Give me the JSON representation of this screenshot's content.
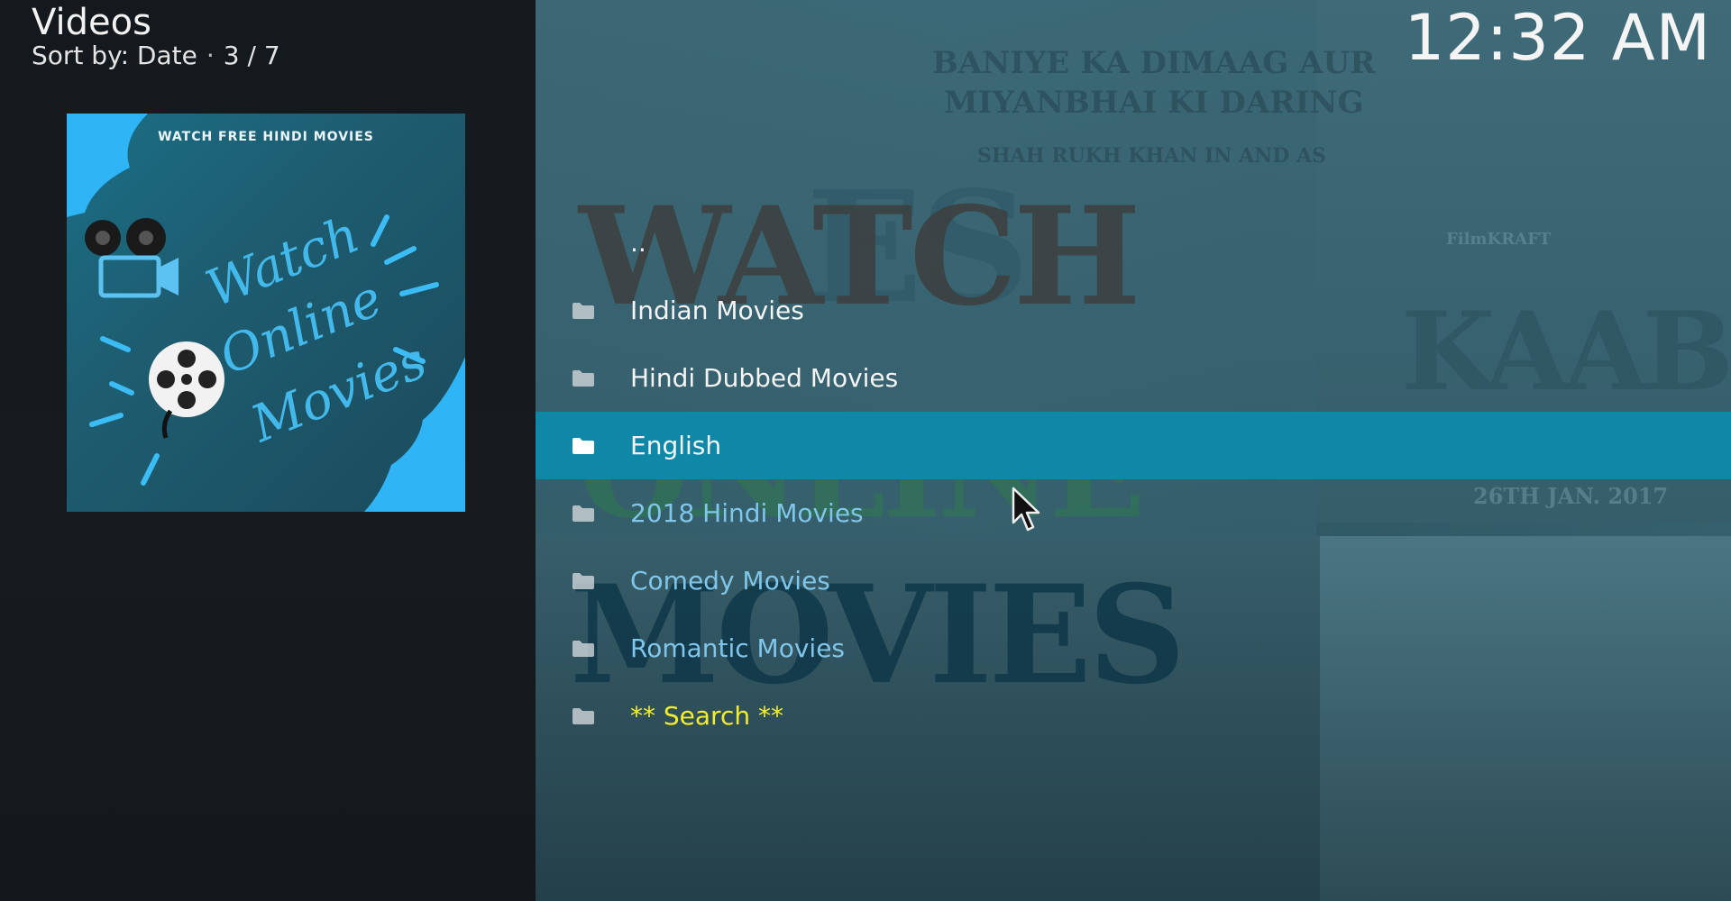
{
  "header": {
    "title": "Videos",
    "sort_label": "Sort by: Date",
    "separator": "·",
    "position": "3 / 7"
  },
  "clock": {
    "time": "12:32 AM"
  },
  "thumbnail": {
    "caption": "WATCH FREE HINDI MOVIES",
    "script_text": "Watch Online Movies"
  },
  "background": {
    "words": [
      "WATCH",
      "ONLINE",
      "MOVIES"
    ],
    "poster_line_1": "BANIYE KA DIMAAG AUR",
    "poster_line_2": "MIYANBHAI KI DARING",
    "poster_line_3": "SHAH RUKH KHAN IN AND AS",
    "poster_studio": "FilmKRAFT",
    "poster_title": "KAABIL",
    "poster_date": "26TH JAN. 2017"
  },
  "list": {
    "items": [
      {
        "label": "..",
        "icon": "none",
        "color": "white",
        "selected": false
      },
      {
        "label": "Indian Movies",
        "icon": "folder-icon",
        "color": "white",
        "selected": false
      },
      {
        "label": "Hindi Dubbed Movies",
        "icon": "folder-icon",
        "color": "white",
        "selected": false
      },
      {
        "label": "English",
        "icon": "folder-icon",
        "color": "white",
        "selected": true
      },
      {
        "label": "2018 Hindi Movies",
        "icon": "folder-icon",
        "color": "blue",
        "selected": false
      },
      {
        "label": "Comedy Movies",
        "icon": "folder-icon",
        "color": "blue",
        "selected": false
      },
      {
        "label": "Romantic Movies",
        "icon": "folder-icon",
        "color": "blue",
        "selected": false
      },
      {
        "label": "** Search **",
        "icon": "folder-icon",
        "color": "yellow",
        "selected": false
      }
    ]
  },
  "colors": {
    "selection": "#0f88a8",
    "label_white": "#f4f4f4",
    "label_blue": "#7fc6ea",
    "label_yellow": "#f4ee2a"
  }
}
